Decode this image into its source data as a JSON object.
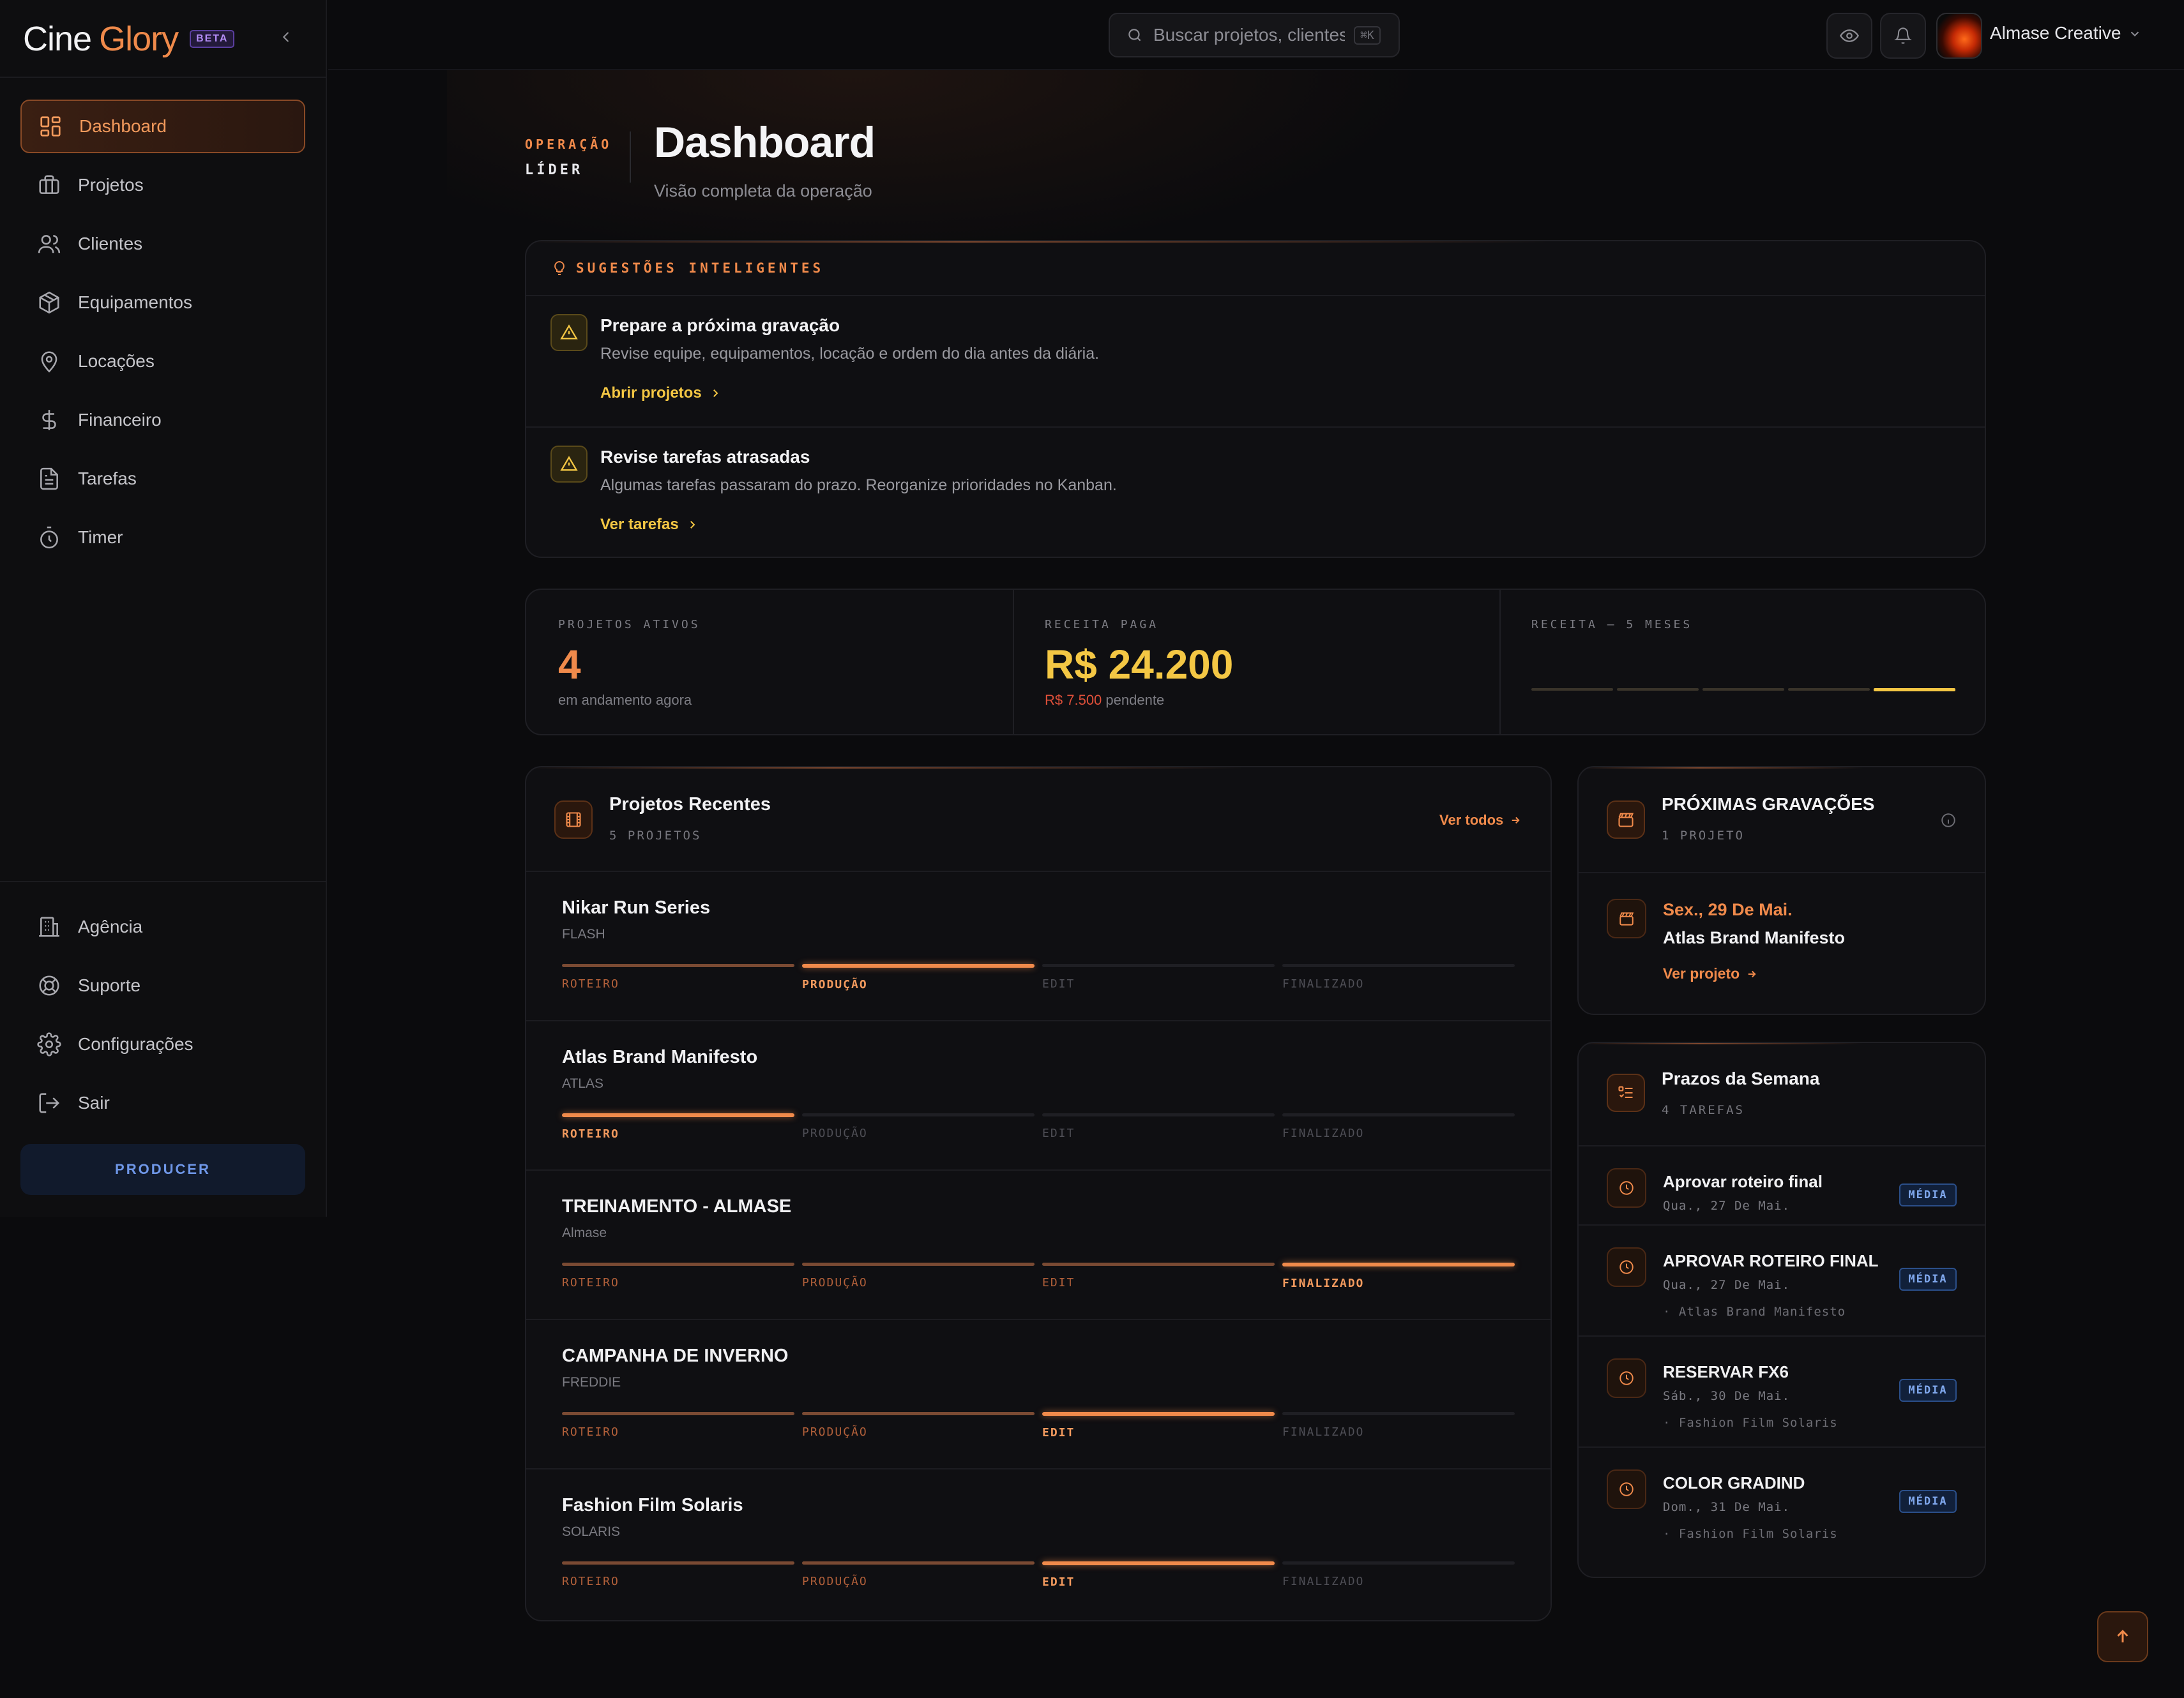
{
  "brand": {
    "name_part1": "Cine",
    "name_part2": "Glory",
    "badge": "BETA"
  },
  "sidebar": {
    "main_items": [
      {
        "label": "Dashboard",
        "icon": "dashboard-icon",
        "active": true
      },
      {
        "label": "Projetos",
        "icon": "briefcase-icon"
      },
      {
        "label": "Clientes",
        "icon": "users-icon"
      },
      {
        "label": "Equipamentos",
        "icon": "box-icon"
      },
      {
        "label": "Locações",
        "icon": "map-pin-icon"
      },
      {
        "label": "Financeiro",
        "icon": "dollar-icon"
      },
      {
        "label": "Tarefas",
        "icon": "file-icon"
      },
      {
        "label": "Timer",
        "icon": "timer-icon"
      }
    ],
    "bottom_items": [
      {
        "label": "Agência",
        "icon": "building-icon"
      },
      {
        "label": "Suporte",
        "icon": "lifebuoy-icon"
      },
      {
        "label": "Configurações",
        "icon": "gear-icon"
      },
      {
        "label": "Sair",
        "icon": "logout-icon"
      }
    ],
    "role_button": "PRODUCER"
  },
  "topbar": {
    "search_placeholder": "Buscar projetos, clientes",
    "search_shortcut": "⌘K",
    "user_name": "Almase Creative"
  },
  "header": {
    "label_line1": "OPERAÇÃO",
    "label_line2": "LÍDER",
    "title": "Dashboard",
    "subtitle": "Visão completa da operação"
  },
  "suggestions": {
    "title": "SUGESTÕES INTELIGENTES",
    "items": [
      {
        "title": "Prepare a próxima gravação",
        "desc": "Revise equipe, equipamentos, locação e ordem do dia antes da diária.",
        "link": "Abrir projetos"
      },
      {
        "title": "Revise tarefas atrasadas",
        "desc": "Algumas tarefas passaram do prazo. Reorganize prioridades no Kanban.",
        "link": "Ver tarefas"
      }
    ]
  },
  "stats": {
    "active_label": "PROJETOS ATIVOS",
    "active_value": "4",
    "active_sub": "em andamento agora",
    "revenue_label": "RECEITA PAGA",
    "revenue_value": "R$ 24.200",
    "pending_value": "R$ 7.500",
    "pending_label": "pendente",
    "trend_label": "RECEITA — 5 MESES",
    "trend_highlight_index": 4
  },
  "projects": {
    "title": "Projetos Recentes",
    "count": "5 PROJETOS",
    "see_all": "Ver todos",
    "stages": [
      "ROTEIRO",
      "PRODUÇÃO",
      "EDIT",
      "FINALIZADO"
    ],
    "items": [
      {
        "name": "Nikar Run Series",
        "client": "FLASH",
        "stage": 1
      },
      {
        "name": "Atlas Brand Manifesto",
        "client": "ATLAS",
        "stage": 0
      },
      {
        "name": "TREINAMENTO - ALMASE",
        "client": "Almase",
        "stage": 3
      },
      {
        "name": "CAMPANHA DE INVERNO",
        "client": "FREDDIE",
        "stage": 2
      },
      {
        "name": "Fashion Film Solaris",
        "client": "SOLARIS",
        "stage": 2
      }
    ]
  },
  "shoots": {
    "title": "PRÓXIMAS GRAVAÇÕES",
    "count": "1 PROJETO",
    "items": [
      {
        "date": "Sex., 29 De Mai.",
        "name": "Atlas Brand Manifesto",
        "link": "Ver projeto"
      }
    ]
  },
  "deadlines": {
    "title": "Prazos da Semana",
    "count": "4 TAREFAS",
    "items": [
      {
        "title": "Aprovar roteiro final",
        "date": "Qua., 27 De Mai.",
        "project": "",
        "priority": "MÉDIA"
      },
      {
        "title": "APROVAR ROTEIRO FINAL",
        "date": "Qua., 27 De Mai.",
        "project": "· Atlas Brand Manifesto",
        "priority": "MÉDIA"
      },
      {
        "title": "RESERVAR FX6",
        "date": "Sáb., 30 De Mai.",
        "project": "· Fashion Film Solaris",
        "priority": "MÉDIA"
      },
      {
        "title": "COLOR GRADIND",
        "date": "Dom., 31 De Mai.",
        "project": "· Fashion Film Solaris",
        "priority": "MÉDIA"
      }
    ]
  },
  "colors": {
    "accent": "#f08a4b",
    "gold": "#f4c744",
    "background": "#0b0b0d",
    "badge_blue": "#7fa7ec"
  }
}
